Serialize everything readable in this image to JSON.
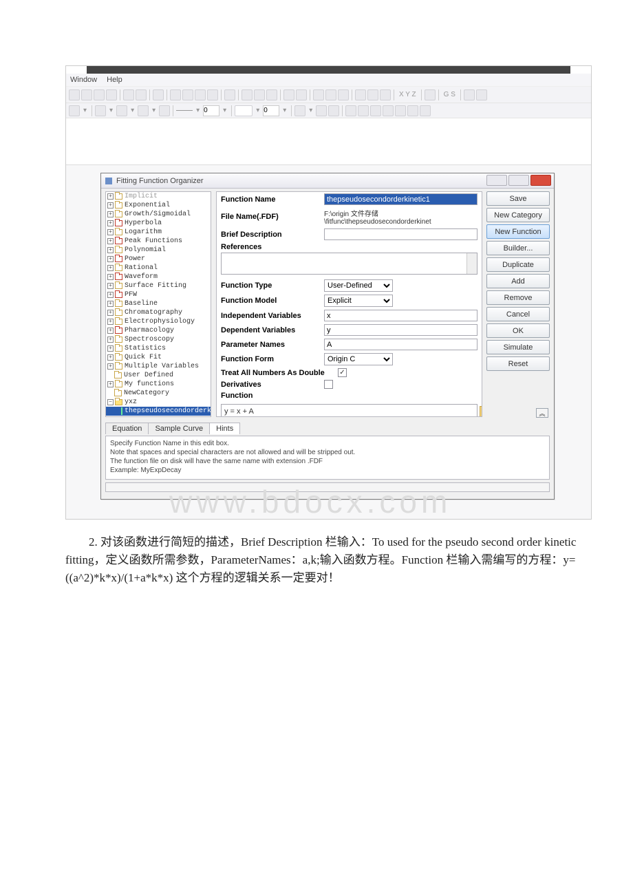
{
  "menu": {
    "window": "Window",
    "help": "Help"
  },
  "toolbar": {
    "num1": "0",
    "num2": "0",
    "xyz": "X  Y  Z",
    "gs": "G  S"
  },
  "dialog": {
    "title": "Fitting Function Organizer",
    "tree_top": "Implicit",
    "tree": [
      {
        "label": "Exponential",
        "red": false
      },
      {
        "label": "Growth/Sigmoidal",
        "red": false
      },
      {
        "label": "Hyperbola",
        "red": true
      },
      {
        "label": "Logarithm",
        "red": false
      },
      {
        "label": "Peak Functions",
        "red": true
      },
      {
        "label": "Polynomial",
        "red": false
      },
      {
        "label": "Power",
        "red": true
      },
      {
        "label": "Rational",
        "red": false
      },
      {
        "label": "Waveform",
        "red": true
      },
      {
        "label": "Surface Fitting",
        "red": false
      },
      {
        "label": "PFW",
        "red": true
      },
      {
        "label": "Baseline",
        "red": false
      },
      {
        "label": "Chromatography",
        "red": false
      },
      {
        "label": "Electrophysiology",
        "red": false
      },
      {
        "label": "Pharmacology",
        "red": true
      },
      {
        "label": "Spectroscopy",
        "red": false
      },
      {
        "label": "Statistics",
        "red": false
      },
      {
        "label": "Quick Fit",
        "red": false
      },
      {
        "label": "Multiple Variables",
        "red": false
      }
    ],
    "user_defined": "User Defined",
    "my_functions": "My functions",
    "new_category": "NewCategory",
    "yxz": "yxz",
    "selected": "thepseudosecondorderkin",
    "labels": {
      "function_name": "Function Name",
      "file_name": "File Name(.FDF)",
      "brief_desc": "Brief Description",
      "references": "References",
      "function_type": "Function Type",
      "function_model": "Function Model",
      "indep_vars": "Independent Variables",
      "dep_vars": "Dependent Variables",
      "param_names": "Parameter Names",
      "function_form": "Function Form",
      "treat_double": "Treat All Numbers As Double",
      "derivatives": "Derivatives",
      "function": "Function"
    },
    "values": {
      "function_name": "thepseudosecondorderkinetic1",
      "file_name": "F:\\origin 文件存储\\fitfunc\\thepseudosecondorderkinet",
      "brief_desc": "",
      "function_type": "User-Defined",
      "function_model": "Explicit",
      "indep": "x",
      "dep": "y",
      "params": "A",
      "form": "Origin C",
      "treat_double": "✓",
      "func_body": "y = x + A"
    },
    "buttons": {
      "save": "Save",
      "new_cat": "New Category",
      "new_fn": "New Function",
      "builder": "Builder...",
      "dup": "Duplicate",
      "add": "Add",
      "remove": "Remove",
      "cancel": "Cancel",
      "ok": "OK",
      "simulate": "Simulate",
      "reset": "Reset"
    },
    "tabs": {
      "equation": "Equation",
      "sample": "Sample Curve",
      "hints": "Hints"
    },
    "hints": {
      "l1": "Specify Function Name in this edit box.",
      "l2": "Note that spaces and special characters are not allowed and will be stripped out.",
      "l3": "The function file on disk will have the same name with extension .FDF",
      "l4": "Example: MyExpDecay"
    }
  },
  "watermark": "www.bdocx.com",
  "doc": {
    "p": "　　2. 对该函数进行简短的描述，Brief Description 栏输入：To used for the pseudo second order kinetic fitting，定义函数所需参数，ParameterNames：a,k;输入函数方程。Function 栏输入需编写的方程：y=((a^2)*k*x)/(1+a*k*x) 这个方程的逻辑关系一定要对！"
  }
}
